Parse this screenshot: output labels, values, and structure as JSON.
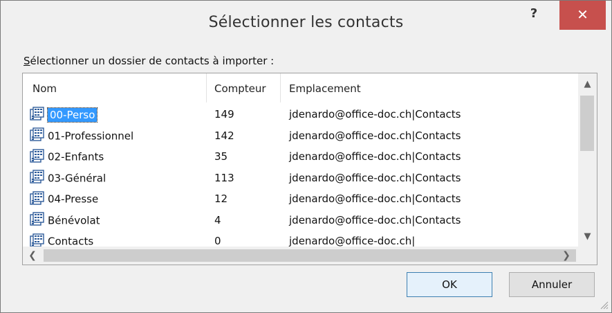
{
  "window": {
    "title": "Sélectionner les contacts",
    "help_label": "?",
    "close_label": "✕"
  },
  "prompt": {
    "first_letter": "S",
    "rest": "électionner un dossier de contacts à importer :"
  },
  "list": {
    "columns": [
      "Nom",
      "Compteur",
      "Emplacement"
    ],
    "rows": [
      {
        "name": "00-Perso",
        "count": "149",
        "location": "jdenardo@office-doc.ch|Contacts",
        "selected": true
      },
      {
        "name": "01-Professionnel",
        "count": "142",
        "location": "jdenardo@office-doc.ch|Contacts"
      },
      {
        "name": "02-Enfants",
        "count": "35",
        "location": "jdenardo@office-doc.ch|Contacts"
      },
      {
        "name": "03-Général",
        "count": "113",
        "location": "jdenardo@office-doc.ch|Contacts"
      },
      {
        "name": "04-Presse",
        "count": "12",
        "location": "jdenardo@office-doc.ch|Contacts"
      },
      {
        "name": "Bénévolat",
        "count": "4",
        "location": "jdenardo@office-doc.ch|Contacts"
      },
      {
        "name": "Contacts",
        "count": "0",
        "location": "jdenardo@office-doc.ch|"
      }
    ],
    "icon": "contacts-folder-icon"
  },
  "buttons": {
    "ok": "OK",
    "cancel": "Annuler"
  },
  "colors": {
    "close_button": "#c7504d",
    "selection": "#3399ff",
    "ok_border": "#3c7fb1"
  }
}
